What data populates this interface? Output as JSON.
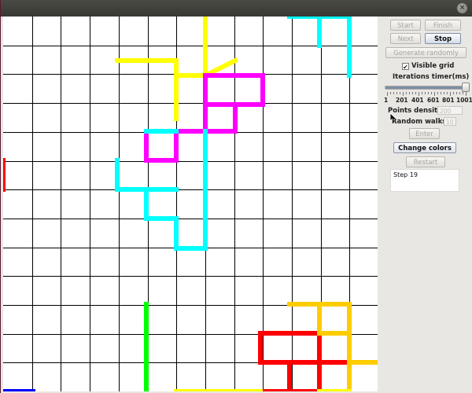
{
  "window": {
    "close_glyph": "×"
  },
  "grid": {
    "visible": true,
    "line_color": "#000000"
  },
  "walks": [
    {
      "color": "#ffff00",
      "segments": [
        [
          145,
          56,
          220,
          56
        ],
        [
          220,
          56,
          220,
          130
        ],
        [
          257,
          0,
          257,
          75
        ],
        [
          220,
          75,
          295,
          75
        ],
        [
          220,
          75,
          220,
          130
        ],
        [
          257,
          75,
          295,
          56
        ]
      ]
    },
    {
      "color": "#ff00ff",
      "segments": [
        [
          257,
          75,
          330,
          75
        ],
        [
          330,
          75,
          330,
          112
        ],
        [
          257,
          112,
          330,
          112
        ],
        [
          257,
          75,
          257,
          146
        ],
        [
          295,
          112,
          295,
          146
        ],
        [
          182,
          146,
          295,
          146
        ],
        [
          182,
          146,
          182,
          183
        ],
        [
          182,
          183,
          220,
          183
        ],
        [
          220,
          146,
          220,
          183
        ]
      ]
    },
    {
      "color": "#00ffff",
      "segments": [
        [
          364,
          0,
          440,
          0
        ],
        [
          402,
          0,
          402,
          37
        ],
        [
          440,
          0,
          440,
          75
        ],
        [
          182,
          146,
          220,
          146
        ],
        [
          257,
          146,
          257,
          295
        ],
        [
          145,
          183,
          145,
          220
        ],
        [
          145,
          220,
          220,
          220
        ],
        [
          182,
          220,
          182,
          257
        ],
        [
          182,
          257,
          220,
          257
        ],
        [
          220,
          257,
          220,
          295
        ],
        [
          220,
          295,
          257,
          295
        ]
      ]
    },
    {
      "color": "#ff0000",
      "segments": [
        [
          0,
          183,
          0,
          220
        ],
        [
          327,
          403,
          402,
          403
        ],
        [
          327,
          403,
          327,
          440
        ],
        [
          327,
          440,
          440,
          440
        ],
        [
          402,
          403,
          402,
          477
        ],
        [
          364,
          440,
          364,
          477
        ],
        [
          327,
          477,
          402,
          477
        ]
      ]
    },
    {
      "color": "#ffcc00",
      "segments": [
        [
          364,
          366,
          440,
          366
        ],
        [
          402,
          366,
          402,
          403
        ],
        [
          440,
          366,
          440,
          477
        ],
        [
          440,
          440,
          477,
          440
        ],
        [
          402,
          403,
          440,
          403
        ]
      ]
    },
    {
      "color": "#00ff00",
      "segments": [
        [
          182,
          366,
          182,
          477
        ]
      ]
    },
    {
      "color": "#0000ff",
      "segments": [
        [
          0,
          477,
          38,
          477
        ]
      ]
    },
    {
      "color": "#ffff00",
      "segments": [
        [
          220,
          477,
          327,
          477
        ],
        [
          402,
          477,
          440,
          477
        ]
      ]
    }
  ],
  "controls": {
    "start": "Start",
    "finish": "Finish",
    "next": "Next",
    "stop": "Stop",
    "generate": "Generate randomly",
    "visible_grid": "Visible grid",
    "visible_grid_checked": true,
    "check_glyph": "✔",
    "iterations_label": "Iterations timer(ms)",
    "slider_value": 1001,
    "slider_min": 1,
    "slider_max": 1001,
    "ticks": [
      "1",
      "201",
      "401",
      "601",
      "801",
      "1001"
    ],
    "points_density_label": "Points density:",
    "points_density_value": "200",
    "random_walks_label": "Random walks:",
    "random_walks_value": "10",
    "enter": "Enter",
    "change_colors": "Change colors",
    "restart": "Restart",
    "status": "Step 19"
  }
}
